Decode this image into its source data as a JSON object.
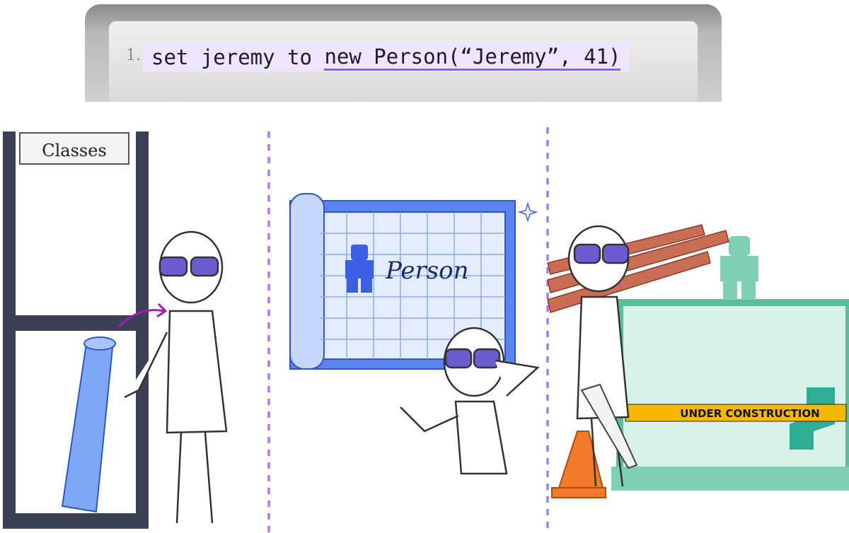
{
  "code": {
    "line_number": "1.",
    "prefix": "set jeremy to ",
    "highlight": "new Person(“Jeremy”, 41)"
  },
  "panels": {
    "shelf_sign": "Classes",
    "blueprint_label": "Person",
    "tape_label": "UNDER CONSTRUCTION"
  },
  "colors": {
    "accent_purple": "#8b5cf6",
    "code_highlight": "#eee6ff",
    "blueprint_blue": "#4f7df3",
    "construction_green": "#7fcfb4",
    "tape_yellow": "#f5b800"
  }
}
